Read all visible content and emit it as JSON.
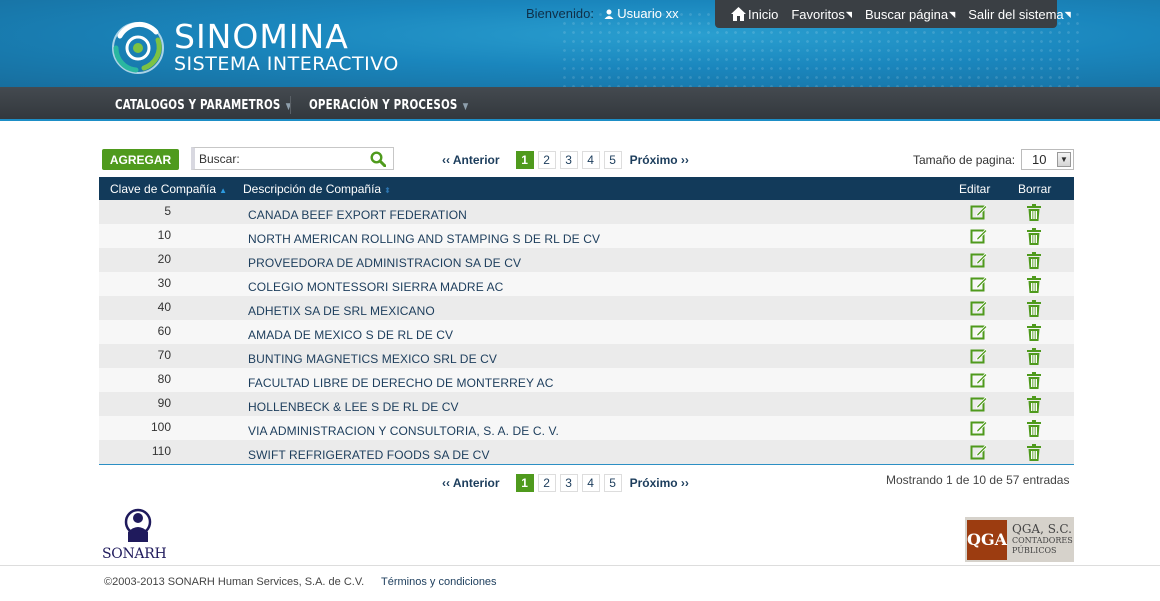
{
  "header": {
    "brand_title": "SINOMINA",
    "brand_subtitle": "SISTEMA INTERACTIVO",
    "welcome_label": "Bienvenido:",
    "user_name": "Usuario xx",
    "top_links": [
      {
        "label": "Inicio",
        "icon": "home-icon"
      },
      {
        "label": "Favoritos",
        "icon": "external-link-icon"
      },
      {
        "label": "Buscar página",
        "icon": "external-link-icon"
      },
      {
        "label": "Salir del sistema",
        "icon": "external-link-icon"
      }
    ]
  },
  "menu": {
    "items": [
      {
        "label": "CATALOGOS Y PARAMETROS"
      },
      {
        "label": "OPERACIÓN Y PROCESOS"
      }
    ]
  },
  "toolbar": {
    "add_label": "AGREGAR",
    "search_placeholder": "Buscar:",
    "page_size_label": "Tamaño de pagina:",
    "page_size_value": "10"
  },
  "pagination": {
    "prev_label": "‹‹ Anterior",
    "next_label": "Próximo ››",
    "pages": [
      "1",
      "2",
      "3",
      "4",
      "5"
    ],
    "active_page": "1"
  },
  "table": {
    "columns": {
      "code": "Clave de Compañía",
      "description": "Descripción de Compañía",
      "edit": "Editar",
      "delete": "Borrar"
    },
    "rows": [
      {
        "code": "5",
        "description": "CANADA BEEF EXPORT FEDERATION"
      },
      {
        "code": "10",
        "description": "NORTH AMERICAN ROLLING AND STAMPING S DE RL DE CV"
      },
      {
        "code": "20",
        "description": "PROVEEDORA DE ADMINISTRACION SA DE CV"
      },
      {
        "code": "30",
        "description": "COLEGIO MONTESSORI SIERRA MADRE AC"
      },
      {
        "code": "40",
        "description": "ADHETIX SA DE SRL MEXICANO"
      },
      {
        "code": "60",
        "description": "AMADA DE MEXICO S DE RL DE CV"
      },
      {
        "code": "70",
        "description": "BUNTING MAGNETICS MEXICO SRL DE CV"
      },
      {
        "code": "80",
        "description": "FACULTAD LIBRE DE DERECHO DE MONTERREY AC"
      },
      {
        "code": "90",
        "description": "HOLLENBECK & LEE S DE RL DE CV"
      },
      {
        "code": "100",
        "description": "VIA ADMINISTRACION Y CONSULTORIA, S. A. DE C. V."
      },
      {
        "code": "110",
        "description": "SWIFT REFRIGERATED FOODS SA DE CV"
      }
    ]
  },
  "summary": "Mostrando 1 de 10 de 57 entradas",
  "footer": {
    "sonarh_logo_text": "SONARH",
    "qga_mark": "QGA",
    "qga_name": "QGA, S.C.",
    "qga_line1": "CONTADORES",
    "qga_line2": "PÚBLICOS",
    "copyright": "©2003-2013 SONARH Human Services, S.A. de C.V.",
    "terms": "Términos y condiciones"
  },
  "colors": {
    "header_blue": "#1a86bd",
    "menu_dark": "#3a3f44",
    "accent_green": "#4f9a1d",
    "table_header": "#123a5a",
    "link_blue": "#1c3d5c"
  }
}
